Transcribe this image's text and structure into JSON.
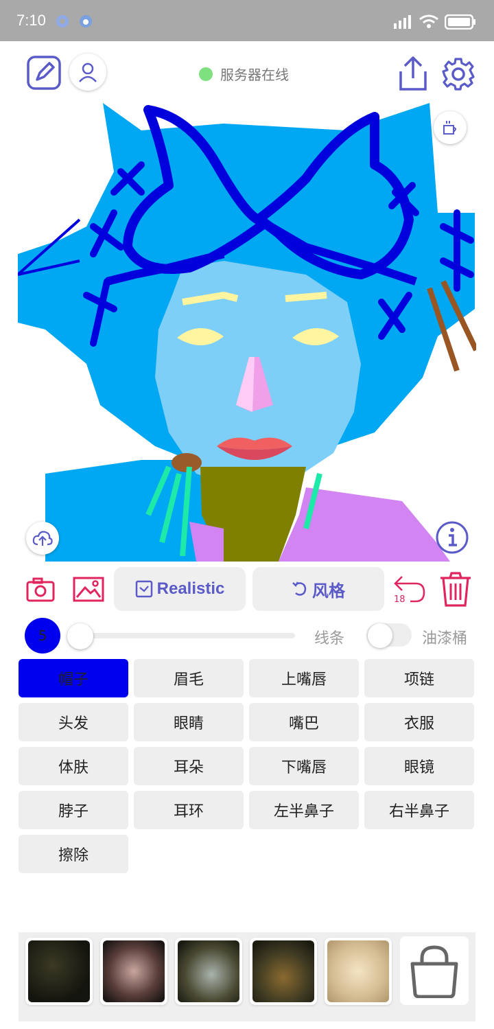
{
  "status_bar": {
    "time": "7:10"
  },
  "header": {
    "server_status": "服务器在线",
    "server_status_color": "#7fe07f"
  },
  "tools": {
    "realistic_label": "Realistic",
    "style_label": "风格",
    "undo_count": "18"
  },
  "brush": {
    "size": "5",
    "line_label": "线条",
    "bucket_label": "油漆桶",
    "bucket_enabled": false,
    "brush_color": "#0000ee"
  },
  "parts": [
    {
      "label": "帽子",
      "active": true
    },
    {
      "label": "眉毛"
    },
    {
      "label": "上嘴唇"
    },
    {
      "label": "项链"
    },
    {
      "label": "头发"
    },
    {
      "label": "眼睛"
    },
    {
      "label": "嘴巴"
    },
    {
      "label": "衣服"
    },
    {
      "label": "体肤"
    },
    {
      "label": "耳朵"
    },
    {
      "label": "下嘴唇"
    },
    {
      "label": "眼镜"
    },
    {
      "label": "脖子"
    },
    {
      "label": "耳环"
    },
    {
      "label": "左半鼻子"
    },
    {
      "label": "右半鼻子"
    },
    {
      "label": "擦除"
    }
  ],
  "colors": {
    "accent": "#5a5ac8",
    "danger": "#e0245e",
    "active_part": "#0000ee"
  }
}
